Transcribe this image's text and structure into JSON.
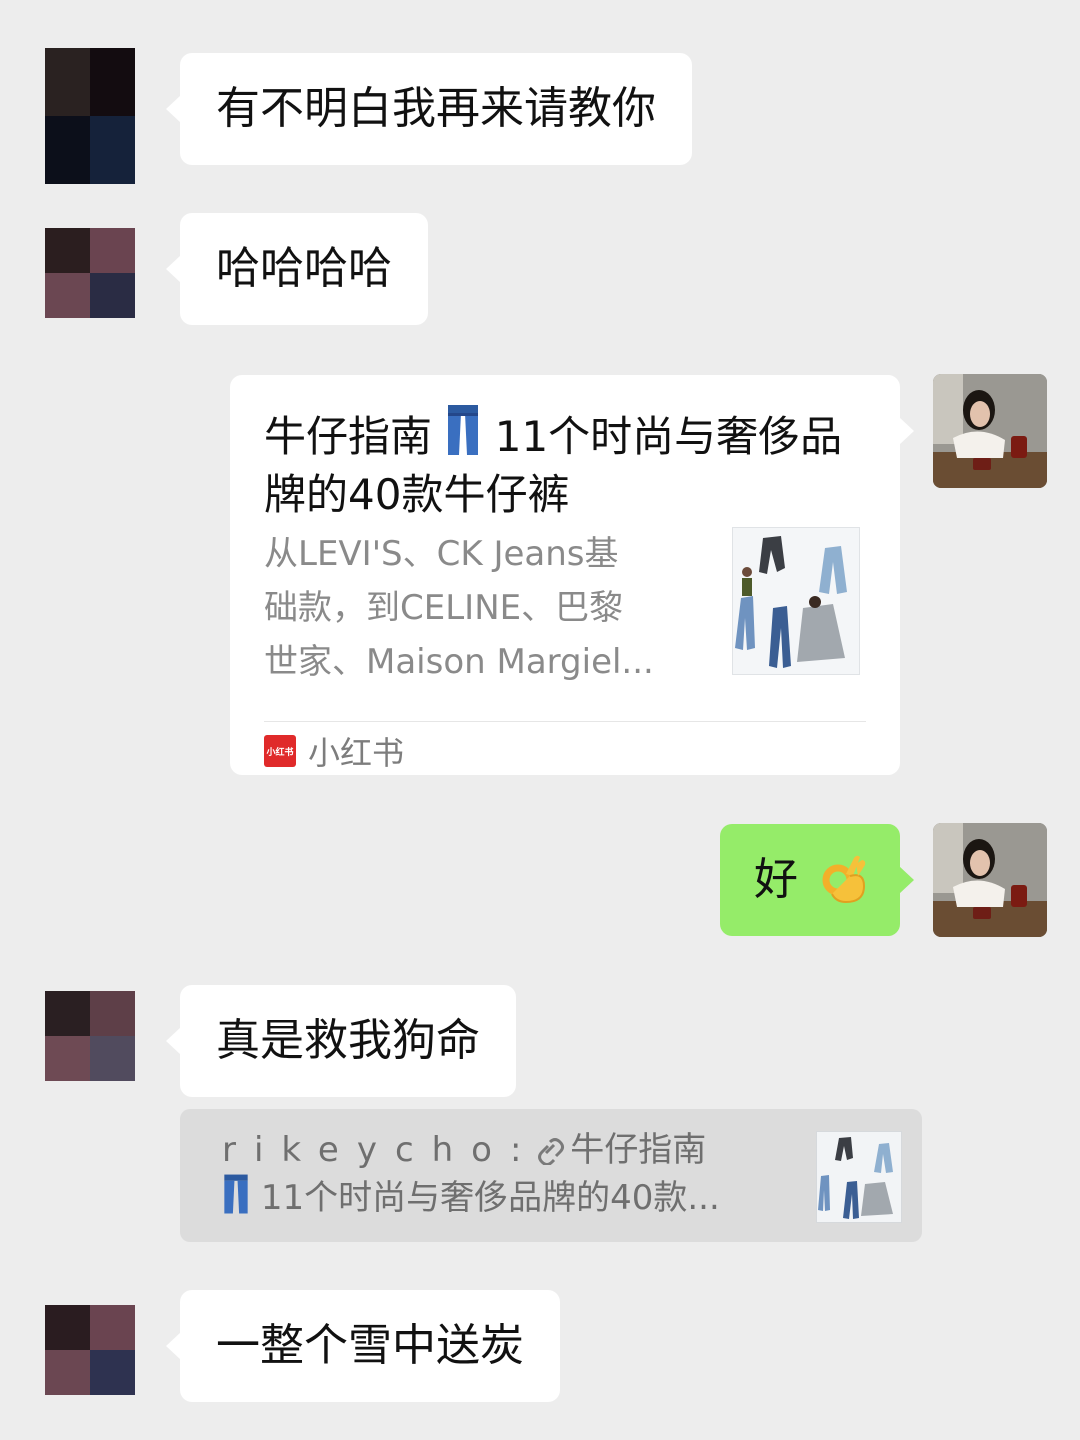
{
  "messages": {
    "m1": {
      "text": "有不明白我再来请教你"
    },
    "m2": {
      "text": "哈哈哈哈"
    },
    "card": {
      "title_a": "牛仔指南",
      "title_b": "11个时尚与奢侈品牌的40款牛仔裤",
      "desc": "从LEVI'S、CK Jeans基\n础款，到CELINE、巴黎\n世家、Maison Margiel...",
      "source": "小红书",
      "source_logo_text": "小红书",
      "thumb_icon": "jeans-collage-thumbnail"
    },
    "m4": {
      "text": "好",
      "emoji": "ok-hand-icon"
    },
    "m5": {
      "text": "真是救我狗命"
    },
    "quote": {
      "name": "rikeycho",
      "sep": ": ",
      "line1_rest": "牛仔指南",
      "line2": "11个时尚与奢侈品牌的40款..."
    },
    "m6": {
      "text": "一整个雪中送炭"
    }
  },
  "colors": {
    "background": "#ededed",
    "bubble_other": "#ffffff",
    "bubble_self": "#95ec69",
    "source_brand": "#e02a2a"
  }
}
